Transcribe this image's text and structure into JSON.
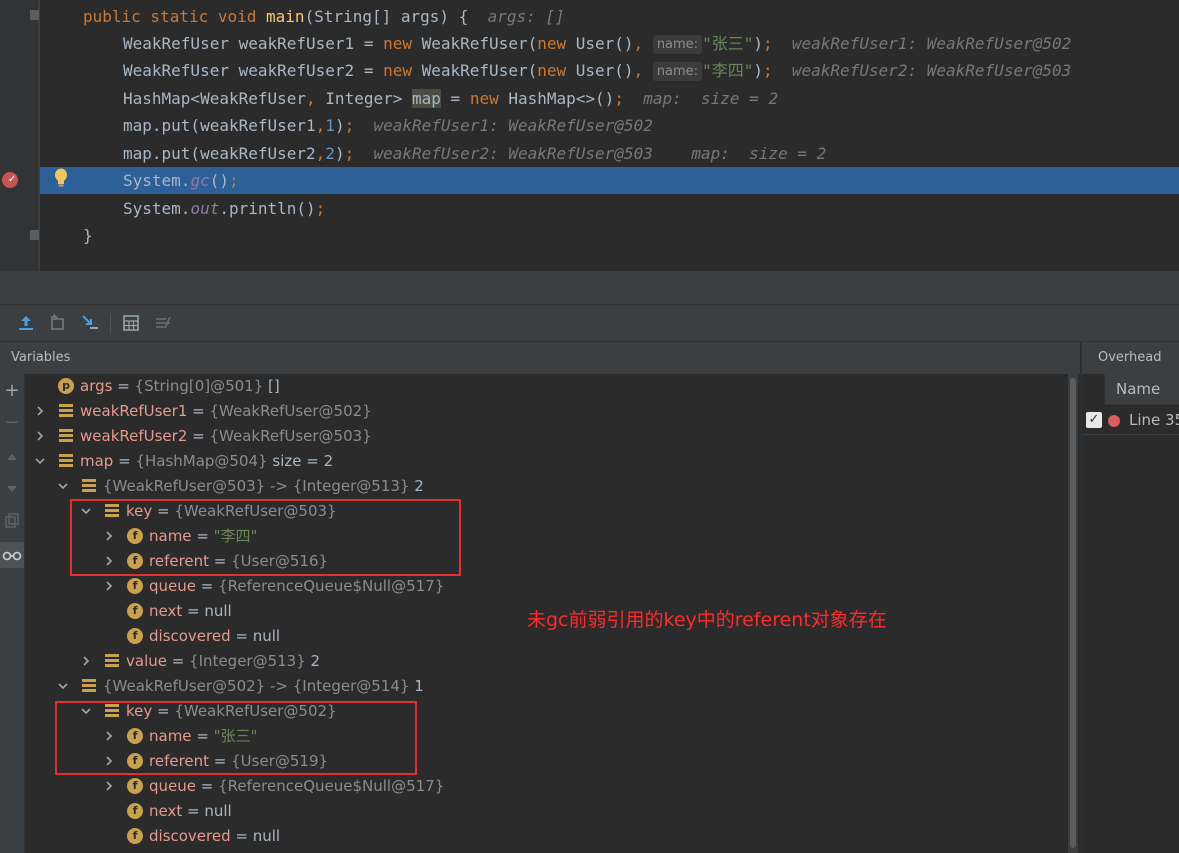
{
  "editor": {
    "lines": [
      {
        "parts": [
          {
            "t": "public static void ",
            "c": "kw"
          },
          {
            "t": "main",
            "c": "fn"
          },
          {
            "t": "(String[] args) {  ",
            "c": ""
          },
          {
            "t": "args: []",
            "c": "hint"
          }
        ]
      },
      {
        "parts": [
          {
            "t": "WeakRefUser weakRefUser1 = ",
            "c": ""
          },
          {
            "t": "new ",
            "c": "kw"
          },
          {
            "t": "WeakRefUser(",
            "c": ""
          },
          {
            "t": "new ",
            "c": "kw"
          },
          {
            "t": "User()",
            "c": ""
          },
          {
            "t": ", ",
            "c": "kw"
          },
          {
            "t": "name:",
            "c": "param-hint"
          },
          {
            "t": "\"张三\"",
            "c": "str"
          },
          {
            "t": ")",
            "c": ""
          },
          {
            "t": ";",
            "c": "kw"
          },
          {
            "t": "  weakRefUser1: WeakRefUser@502",
            "c": "hint"
          }
        ]
      },
      {
        "parts": [
          {
            "t": "WeakRefUser weakRefUser2 = ",
            "c": ""
          },
          {
            "t": "new ",
            "c": "kw"
          },
          {
            "t": "WeakRefUser(",
            "c": ""
          },
          {
            "t": "new ",
            "c": "kw"
          },
          {
            "t": "User()",
            "c": ""
          },
          {
            "t": ", ",
            "c": "kw"
          },
          {
            "t": "name:",
            "c": "param-hint"
          },
          {
            "t": "\"李四\"",
            "c": "str"
          },
          {
            "t": ")",
            "c": ""
          },
          {
            "t": ";",
            "c": "kw"
          },
          {
            "t": "  weakRefUser2: WeakRefUser@503",
            "c": "hint"
          }
        ]
      },
      {
        "parts": [
          {
            "t": "HashMap<WeakRefUser",
            "c": ""
          },
          {
            "t": ", ",
            "c": "kw"
          },
          {
            "t": "Integer> ",
            "c": ""
          },
          {
            "t": "map",
            "c": "var-hl"
          },
          {
            "t": " = ",
            "c": ""
          },
          {
            "t": "new ",
            "c": "kw"
          },
          {
            "t": "HashMap<>()",
            "c": ""
          },
          {
            "t": ";",
            "c": "kw"
          },
          {
            "t": "  map:  size = 2",
            "c": "hint"
          }
        ]
      },
      {
        "parts": [
          {
            "t": "map.put(weakRefUser1",
            "c": ""
          },
          {
            "t": ",",
            "c": "kw"
          },
          {
            "t": "1",
            "c": "num"
          },
          {
            "t": ")",
            "c": ""
          },
          {
            "t": ";",
            "c": "kw"
          },
          {
            "t": "  weakRefUser1: WeakRefUser@502",
            "c": "hint"
          }
        ]
      },
      {
        "parts": [
          {
            "t": "map.put(weakRefUser2",
            "c": ""
          },
          {
            "t": ",",
            "c": "kw"
          },
          {
            "t": "2",
            "c": "num"
          },
          {
            "t": ")",
            "c": ""
          },
          {
            "t": ";",
            "c": "kw"
          },
          {
            "t": "  weakRefUser2: WeakRefUser@503    map:  size = 2",
            "c": "hint"
          }
        ]
      },
      {
        "parts": [
          {
            "t": "System.",
            "c": ""
          },
          {
            "t": "gc",
            "c": "static-m"
          },
          {
            "t": "()",
            "c": ""
          },
          {
            "t": ";",
            "c": "kw"
          }
        ]
      },
      {
        "parts": [
          {
            "t": "System.",
            "c": ""
          },
          {
            "t": "out",
            "c": "static-m"
          },
          {
            "t": ".println()",
            "c": ""
          },
          {
            "t": ";",
            "c": "kw"
          }
        ]
      },
      {
        "parts": [
          {
            "t": "}",
            "c": ""
          }
        ]
      }
    ]
  },
  "variables_panel": {
    "title": "Variables",
    "rows": [
      {
        "name": "args",
        "eq": " = ",
        "ref": "{String[0]@501}",
        "extra": " []",
        "icon": "p",
        "arrow": "none"
      },
      {
        "name": "weakRefUser1",
        "eq": " = ",
        "ref": "{WeakRefUser@502}",
        "extra": "",
        "icon": "obj",
        "arrow": "right"
      },
      {
        "name": "weakRefUser2",
        "eq": " = ",
        "ref": "{WeakRefUser@503}",
        "extra": "",
        "icon": "obj",
        "arrow": "right"
      },
      {
        "name": "map",
        "eq": " = ",
        "ref": "{HashMap@504}",
        "extra": "  size = 2",
        "icon": "obj",
        "arrow": "down"
      },
      {
        "name": "",
        "eq": "",
        "ref": "{WeakRefUser@503}  -> {Integer@513}",
        "extra": " 2",
        "icon": "obj",
        "arrow": "down"
      },
      {
        "name": "key",
        "eq": " = ",
        "ref": "{WeakRefUser@503}",
        "extra": "",
        "icon": "obj",
        "arrow": "down"
      },
      {
        "name": "name",
        "eq": " = ",
        "ref": "",
        "extra": "",
        "str": "\"李四\"",
        "icon": "f",
        "arrow": "right"
      },
      {
        "name": "referent",
        "eq": " = ",
        "ref": "{User@516}",
        "extra": "",
        "icon": "f",
        "arrow": "right"
      },
      {
        "name": "queue",
        "eq": " = ",
        "ref": "{ReferenceQueue$Null@517}",
        "extra": "",
        "icon": "f",
        "arrow": "right"
      },
      {
        "name": "next",
        "eq": " = ",
        "ref": "",
        "extra": "null",
        "icon": "f",
        "arrow": "none"
      },
      {
        "name": "discovered",
        "eq": " = ",
        "ref": "",
        "extra": "null",
        "icon": "f",
        "arrow": "none"
      },
      {
        "name": "value",
        "eq": " = ",
        "ref": "{Integer@513}",
        "extra": " 2",
        "icon": "obj",
        "arrow": "right"
      },
      {
        "name": "",
        "eq": "",
        "ref": "{WeakRefUser@502}  -> {Integer@514}",
        "extra": " 1",
        "icon": "obj",
        "arrow": "down"
      },
      {
        "name": "key",
        "eq": " = ",
        "ref": "{WeakRefUser@502}",
        "extra": "",
        "icon": "obj",
        "arrow": "down"
      },
      {
        "name": "name",
        "eq": " = ",
        "ref": "",
        "extra": "",
        "str": "\"张三\"",
        "icon": "f",
        "arrow": "right"
      },
      {
        "name": "referent",
        "eq": " = ",
        "ref": "{User@519}",
        "extra": "",
        "icon": "f",
        "arrow": "right"
      },
      {
        "name": "queue",
        "eq": " = ",
        "ref": "{ReferenceQueue$Null@517}",
        "extra": "",
        "icon": "f",
        "arrow": "right"
      },
      {
        "name": "next",
        "eq": " = ",
        "ref": "",
        "extra": "null",
        "icon": "f",
        "arrow": "none"
      },
      {
        "name": "discovered",
        "eq": " = ",
        "ref": "",
        "extra": "null",
        "icon": "f",
        "arrow": "none"
      }
    ]
  },
  "annotation": "未gc前弱引用的key中的referent对象存在",
  "overhead_panel": {
    "tab": "Overhead",
    "column_header": "Name",
    "row_label": "Line 35"
  },
  "colors": {
    "editor_bg": "#2b2b2b",
    "current_line": "#2d5f99",
    "keyword": "#cc7832",
    "string": "#6a8759",
    "annotation_red": "#ff2a2a",
    "highlight_box": "#e52e2e"
  },
  "icons": [
    "lightbulb-icon",
    "breakpoint-icon",
    "step-out-icon",
    "drop-frame-icon",
    "run-to-cursor-icon",
    "evaluate-icon",
    "trace-icon",
    "add-watch-icon",
    "remove-watch-icon",
    "move-up-icon",
    "move-down-icon",
    "copy-icon",
    "glasses-icon"
  ]
}
